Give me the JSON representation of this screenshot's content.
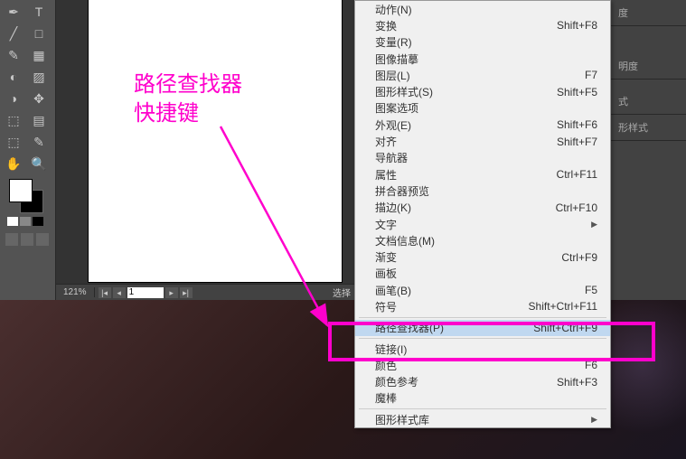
{
  "annotation": {
    "line1": "路径查找器",
    "line2": "快捷键"
  },
  "status": {
    "zoom": "121%",
    "page": "1",
    "select_text": "选择"
  },
  "menu": [
    {
      "label": "动作(N)",
      "shortcut": "",
      "sep": false
    },
    {
      "label": "变换",
      "shortcut": "Shift+F8",
      "sep": false
    },
    {
      "label": "变量(R)",
      "shortcut": "",
      "sep": false
    },
    {
      "label": "图像描摹",
      "shortcut": "",
      "sep": false
    },
    {
      "label": "图层(L)",
      "shortcut": "F7",
      "sep": false
    },
    {
      "label": "图形样式(S)",
      "shortcut": "Shift+F5",
      "sep": false
    },
    {
      "label": "图案选项",
      "shortcut": "",
      "sep": false
    },
    {
      "label": "外观(E)",
      "shortcut": "Shift+F6",
      "sep": false
    },
    {
      "label": "对齐",
      "shortcut": "Shift+F7",
      "sep": false
    },
    {
      "label": "导航器",
      "shortcut": "",
      "sep": false
    },
    {
      "label": "属性",
      "shortcut": "Ctrl+F11",
      "sep": false
    },
    {
      "label": "拼合器预览",
      "shortcut": "",
      "sep": false
    },
    {
      "label": "描边(K)",
      "shortcut": "Ctrl+F10",
      "sep": false
    },
    {
      "label": "文字",
      "shortcut": "",
      "arrow": true,
      "sep": false
    },
    {
      "label": "文档信息(M)",
      "shortcut": "",
      "sep": false
    },
    {
      "label": "渐变",
      "shortcut": "Ctrl+F9",
      "sep": false
    },
    {
      "label": "画板",
      "shortcut": "",
      "sep": false
    },
    {
      "label": "画笔(B)",
      "shortcut": "F5",
      "sep": false
    },
    {
      "label": "符号",
      "shortcut": "Shift+Ctrl+F11",
      "sep": false
    },
    {
      "sep": true
    },
    {
      "label": "路径查找器(P)",
      "shortcut": "Shift+Ctrl+F9",
      "highlighted": true,
      "sep": false
    },
    {
      "sep": true
    },
    {
      "label": "链接(I)",
      "shortcut": "",
      "sep": false
    },
    {
      "label": "颜色",
      "shortcut": "F6",
      "sep": false
    },
    {
      "label": "颜色参考",
      "shortcut": "Shift+F3",
      "sep": false
    },
    {
      "label": "魔棒",
      "shortcut": "",
      "sep": false
    },
    {
      "sep": true
    },
    {
      "label": "图形样式库",
      "shortcut": "",
      "arrow": true,
      "sep": false
    }
  ],
  "right_panel": {
    "tab1": "度",
    "tab2": "明度",
    "tab3": "式",
    "tab4": "形样式"
  },
  "tools": {
    "r1c1": "✒",
    "r1c2": "T",
    "r2c1": "╱",
    "r2c2": "□",
    "r3c1": "✎",
    "r3c2": "▦",
    "r4c1": "◐",
    "r4c2": "▨",
    "r5c1": "◑",
    "r5c2": "✥",
    "r6c1": "⬚",
    "r6c2": "▤",
    "r7c1": "⬚",
    "r7c2": "✎",
    "r8c1": "✋",
    "r8c2": "🔍"
  }
}
